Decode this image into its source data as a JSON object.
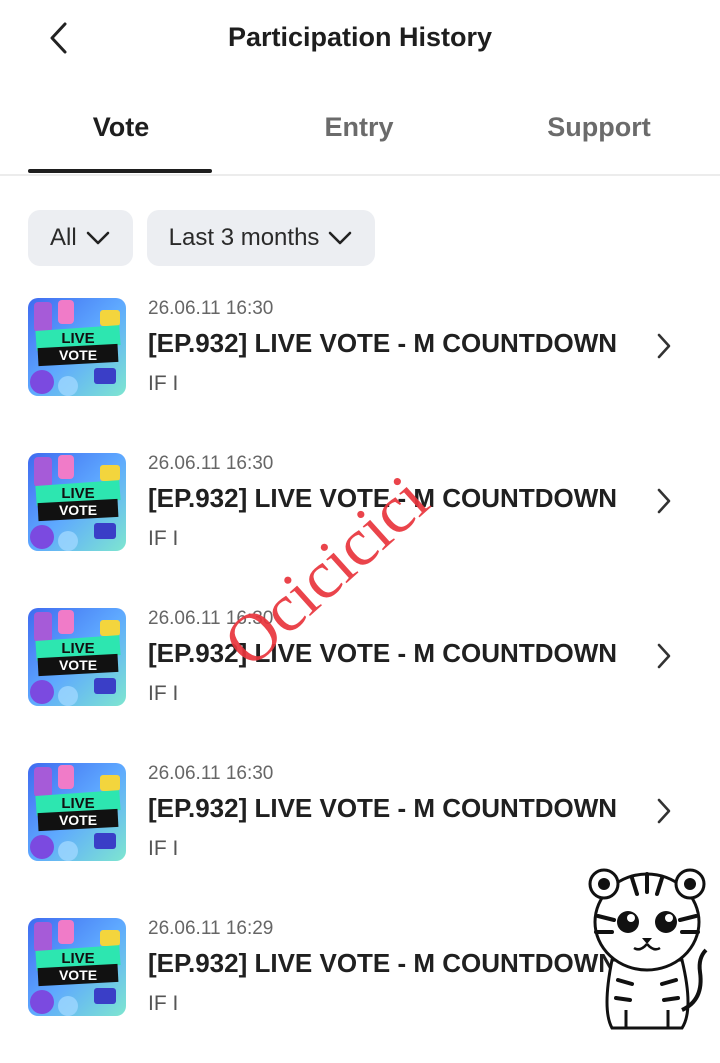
{
  "header": {
    "title": "Participation History",
    "back_icon": "chevron-left-icon"
  },
  "tabs": [
    {
      "label": "Vote",
      "active": true
    },
    {
      "label": "Entry",
      "active": false
    },
    {
      "label": "Support",
      "active": false
    }
  ],
  "filters": {
    "type": {
      "value": "All",
      "icon": "chevron-down-icon"
    },
    "period": {
      "value": "Last 3 months",
      "icon": "chevron-down-icon"
    }
  },
  "items": [
    {
      "date": "26.06.11 16:30",
      "title": "[EP.932] LIVE VOTE - M COUNTDOWN",
      "artist": "IF I",
      "thumb_text_1": "LIVE",
      "thumb_text_2": "VOTE"
    },
    {
      "date": "26.06.11 16:30",
      "title": "[EP.932] LIVE VOTE - M COUNTDOWN",
      "artist": "IF I",
      "thumb_text_1": "LIVE",
      "thumb_text_2": "VOTE"
    },
    {
      "date": "26.06.11 16:30",
      "title": "[EP.932] LIVE VOTE - M COUNTDOWN",
      "artist": "IF I",
      "thumb_text_1": "LIVE",
      "thumb_text_2": "VOTE"
    },
    {
      "date": "26.06.11 16:30",
      "title": "[EP.932] LIVE VOTE - M COUNTDOWN",
      "artist": "IF I",
      "thumb_text_1": "LIVE",
      "thumb_text_2": "VOTE"
    },
    {
      "date": "26.06.11 16:29",
      "title": "[EP.932] LIVE VOTE - M COUNTDOWN",
      "artist": "IF I",
      "thumb_text_1": "LIVE",
      "thumb_text_2": "VOTE"
    }
  ],
  "watermark": {
    "text": "Ocicicici",
    "color": "#e8343c"
  },
  "colors": {
    "text": "#1e1e1e",
    "muted": "#6b6b6b",
    "chip_bg": "#eceef2"
  }
}
